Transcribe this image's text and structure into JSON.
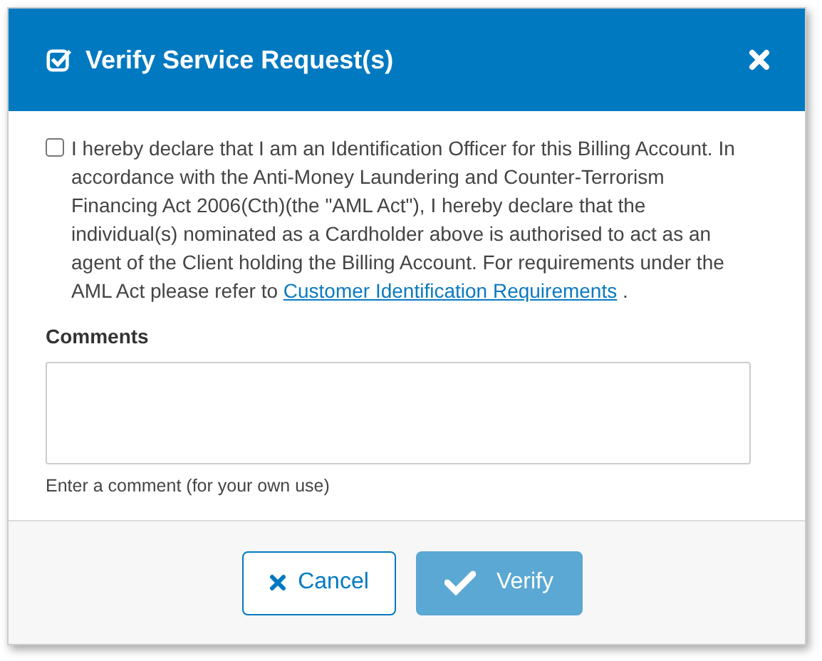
{
  "dialog": {
    "title": "Verify Service Request(s)"
  },
  "declaration": {
    "checked": false,
    "text": "I hereby declare that I am an Identification Officer for this Billing Account. In accordance with the Anti-Money Laundering and Counter-Terrorism Financing Act 2006(Cth)(the \"AML Act\"), I hereby declare that the individual(s) nominated as a Cardholder above is authorised to act as an agent of the Client holding the Billing Account. For requirements under the AML Act please refer to",
    "link": "Customer Identification Requirements",
    "end": "."
  },
  "comments": {
    "label": "Comments",
    "help": "Enter a comment (for your own use)"
  },
  "buttons": [
    {
      "kind": "cancel",
      "label": "Cancel",
      "disabled": false
    },
    {
      "kind": "verify",
      "label": "Verify",
      "disabled": true
    }
  ]
}
